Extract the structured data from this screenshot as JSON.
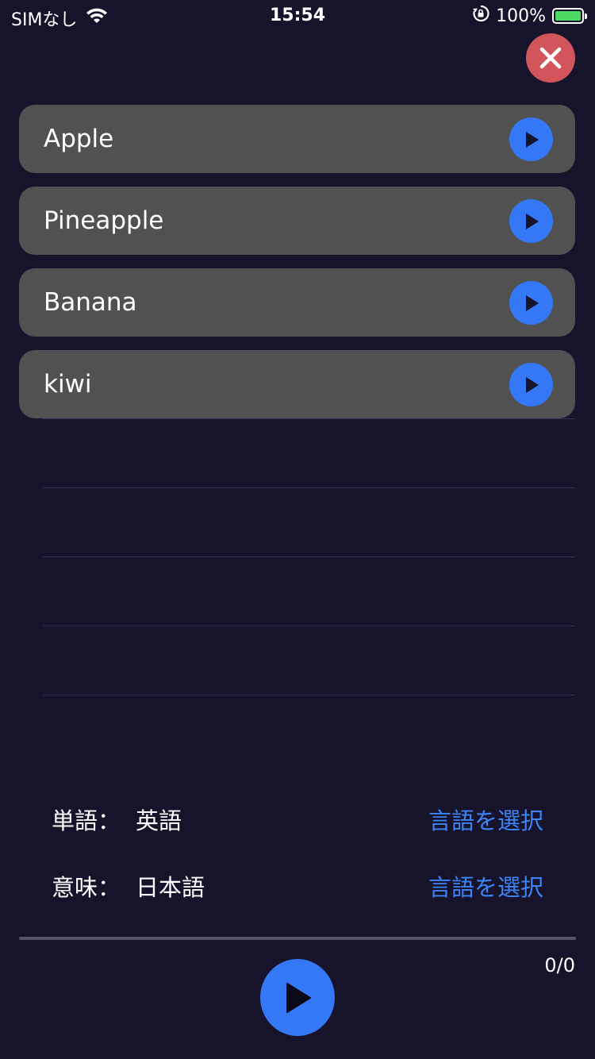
{
  "status_bar": {
    "carrier": "SIMなし",
    "time": "15:54",
    "battery_text": "100%",
    "battery_level": 1.0
  },
  "close_button": {
    "icon": "close-icon",
    "color": "#d2555c"
  },
  "word_list": {
    "items": [
      {
        "label": "Apple"
      },
      {
        "label": "Pineapple"
      },
      {
        "label": "Banana"
      },
      {
        "label": "kiwi"
      }
    ],
    "play_icon": "play-icon",
    "accent": "#3478f6"
  },
  "language_settings": {
    "word": {
      "label": "単語：",
      "value": "英語",
      "select_label": "言語を選択"
    },
    "meaning": {
      "label": "意味：",
      "value": "日本語",
      "select_label": "言語を選択"
    }
  },
  "playback": {
    "counter": "0/0",
    "progress": 0,
    "play_icon": "play-icon"
  }
}
